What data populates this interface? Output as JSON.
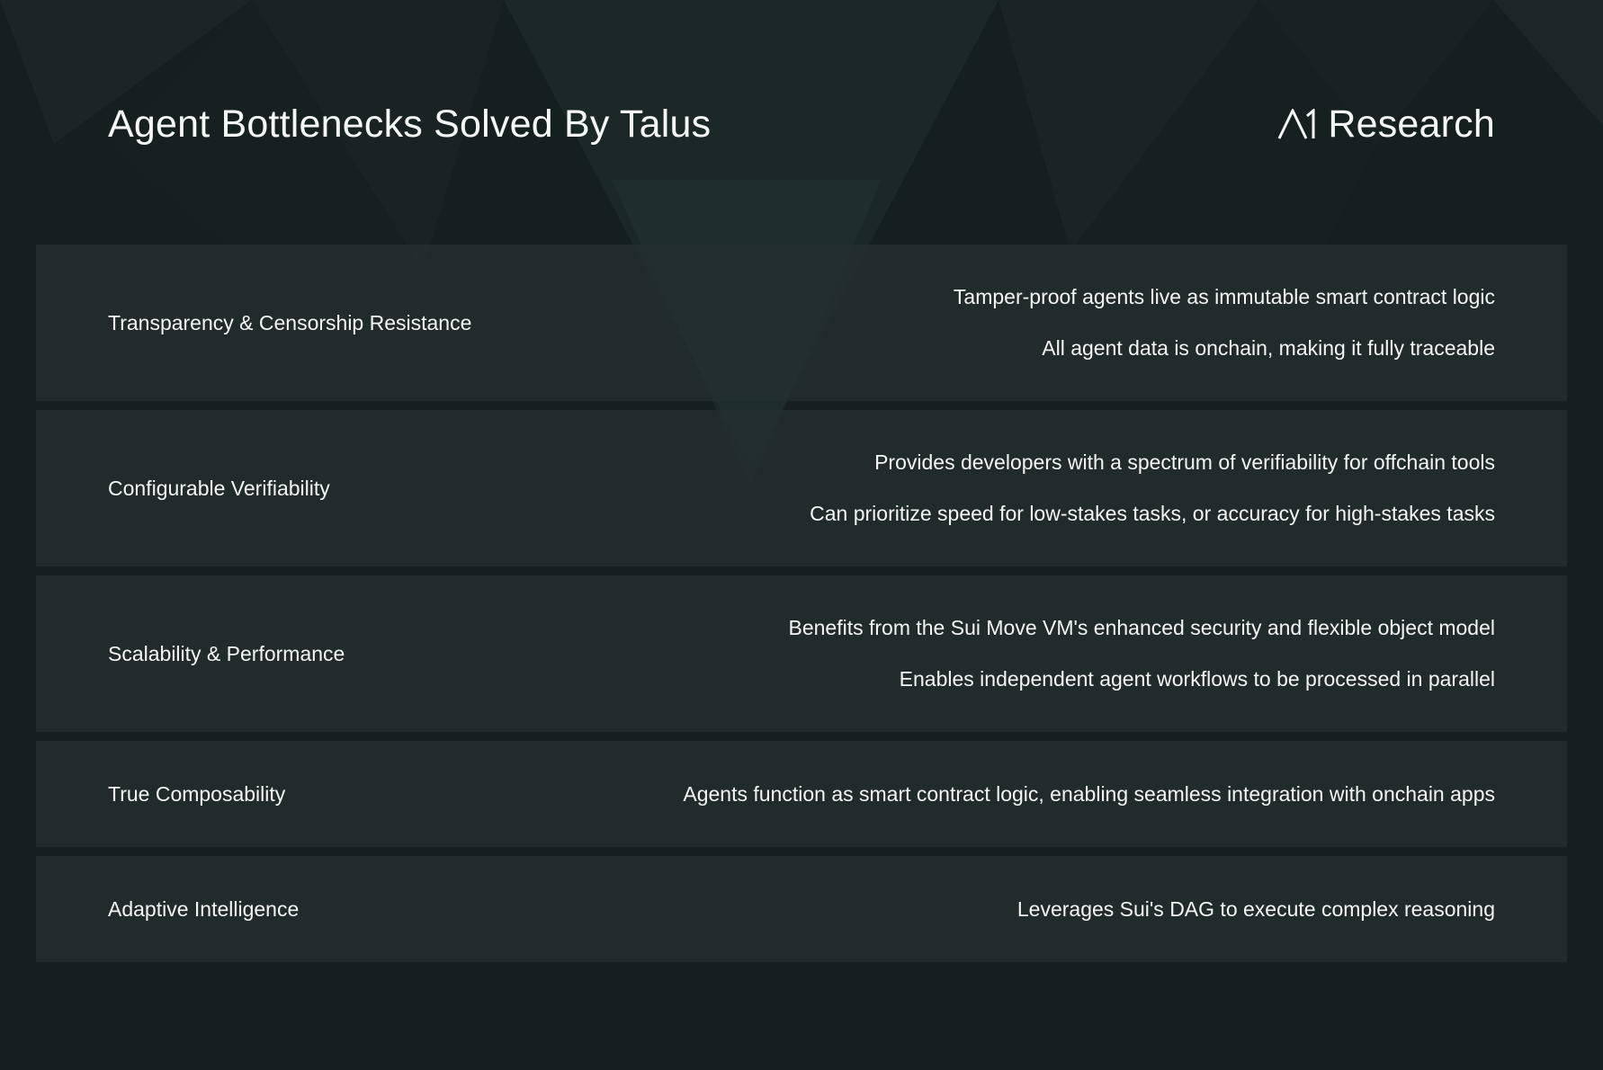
{
  "header": {
    "title": "Agent Bottlenecks Solved By Talus",
    "brand_name": "Research",
    "brand_logo_text": "A1"
  },
  "colors": {
    "background": "#151f1f",
    "row_background": "#242e2e",
    "text": "#f2f5f4"
  },
  "rows": [
    {
      "label": "Transparency & Censorship Resistance",
      "points": [
        "Tamper-proof agents live as immutable smart contract logic",
        "All agent data is onchain, making it fully traceable"
      ]
    },
    {
      "label": "Configurable Verifiability",
      "points": [
        "Provides developers with a spectrum of verifiability for offchain tools",
        "Can prioritize speed for low-stakes tasks, or accuracy for high-stakes tasks"
      ]
    },
    {
      "label": "Scalability & Performance",
      "points": [
        "Benefits from the Sui Move VM's enhanced security and flexible object model",
        "Enables independent agent workflows to be processed in parallel"
      ]
    },
    {
      "label": "True Composability",
      "points": [
        "Agents function as smart contract logic, enabling seamless integration with onchain apps"
      ]
    },
    {
      "label": "Adaptive Intelligence",
      "points": [
        "Leverages Sui's DAG to execute complex reasoning"
      ]
    }
  ]
}
